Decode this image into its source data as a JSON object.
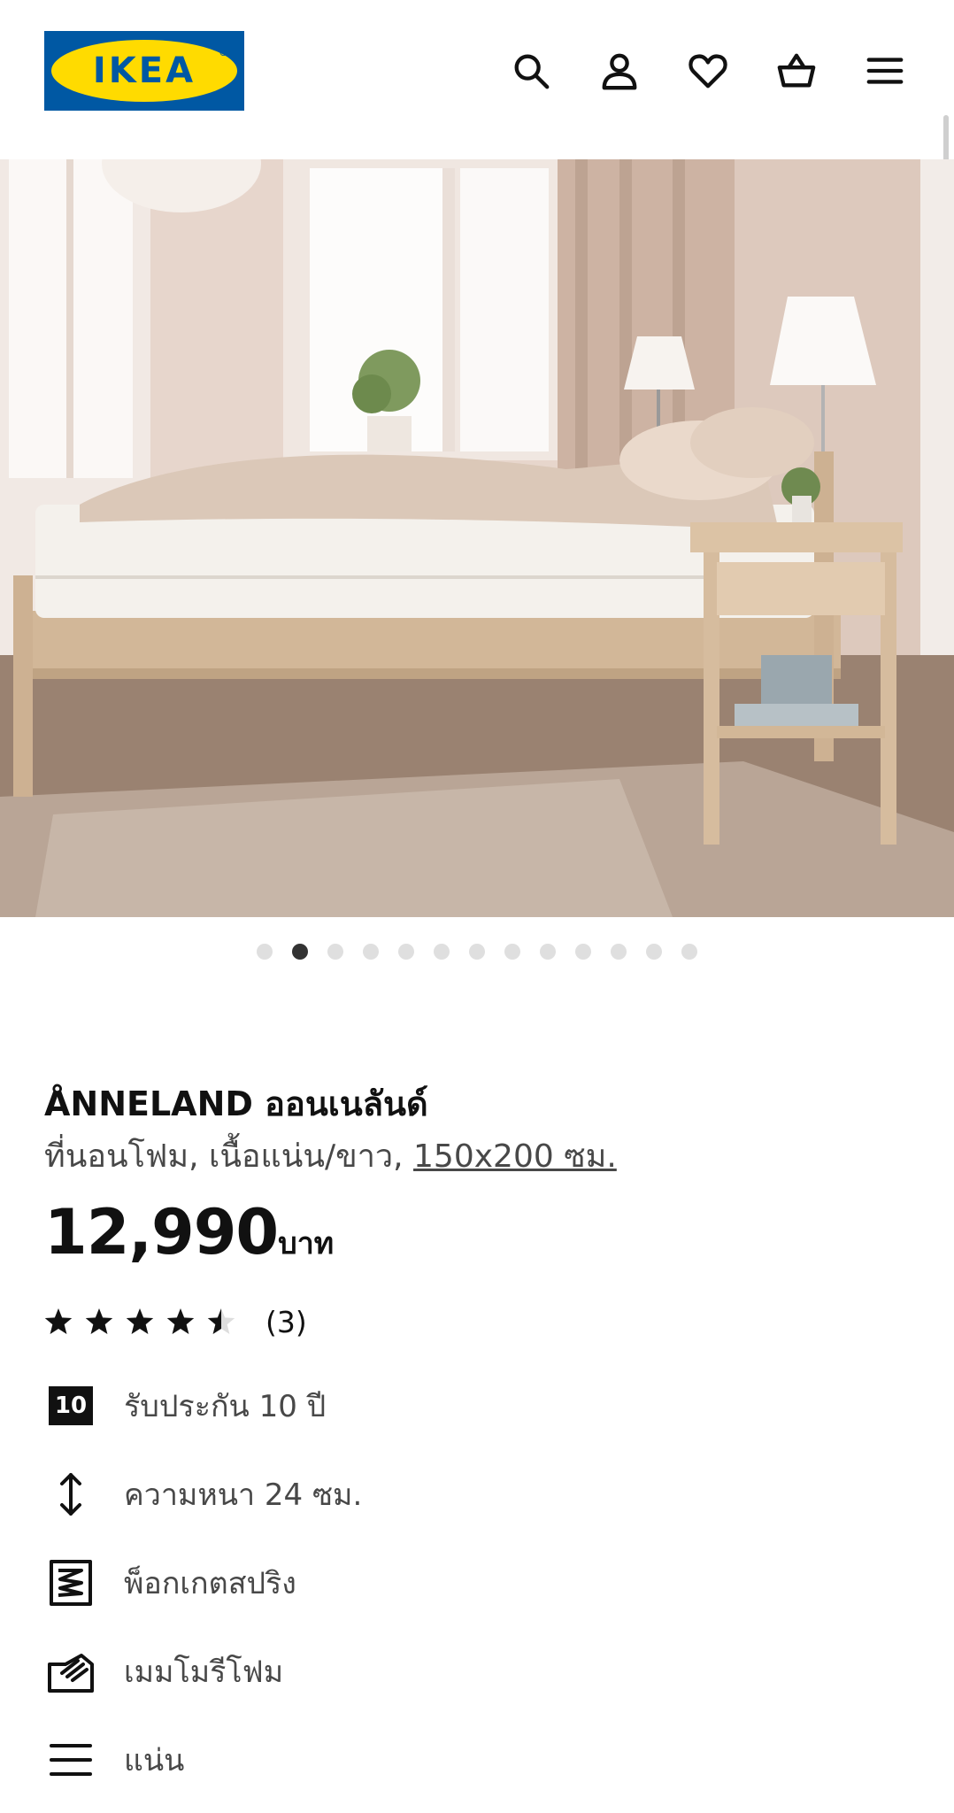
{
  "header": {
    "logo_text": "IKEA",
    "logo_reg": "®",
    "icons": [
      "search-icon",
      "account-icon",
      "heart-icon",
      "basket-icon",
      "menu-icon"
    ]
  },
  "gallery": {
    "total_images": 13,
    "active_index": 1
  },
  "product": {
    "name": "ÅNNELAND ออนเนลันด์",
    "description_prefix": "ที่นอนโฟม, เนื้อแน่น/ขาว, ",
    "size_link": "150x200 ซม.",
    "price": "12,990",
    "currency": "บาท",
    "rating_value": 4.5,
    "rating_count": "(3)"
  },
  "features": [
    {
      "icon": "warranty-10-icon",
      "badge": "10",
      "label": "รับประกัน 10 ปี"
    },
    {
      "icon": "thickness-icon",
      "label": "ความหนา 24 ซม."
    },
    {
      "icon": "pocket-spring-icon",
      "label": "พ็อกเกตสปริง"
    },
    {
      "icon": "memory-foam-icon",
      "label": "เมมโมรีโฟม"
    },
    {
      "icon": "firmness-icon",
      "label": "แน่น"
    }
  ],
  "colors": {
    "ikea_blue": "#0058a3",
    "ikea_yellow": "#ffdb00",
    "text": "#111111",
    "muted": "#484848",
    "dot_active": "#333333",
    "dot_inactive": "#dfdfdf"
  }
}
